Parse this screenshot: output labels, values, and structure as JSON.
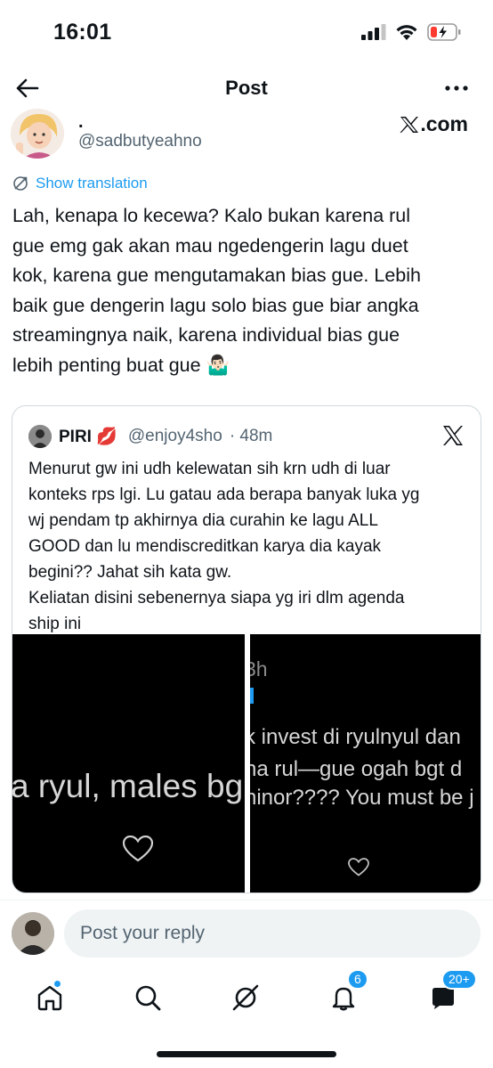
{
  "status_bar": {
    "time": "16:01"
  },
  "nav": {
    "title": "Post"
  },
  "author": {
    "name": ".",
    "handle": "@sadbutyeahno"
  },
  "watermark": {
    "text": ".com"
  },
  "translate": {
    "label": "Show translation"
  },
  "post": {
    "lines": [
      "Lah, kenapa lo kecewa? Kalo bukan karena rul",
      "gue emg gak akan mau ngedengerin lagu duet",
      "kok, karena gue mengutamakan bias gue. Lebih",
      "baik gue dengerin lagu solo bias gue biar angka",
      "streamingnya naik, karena individual bias gue",
      "lebih penting buat gue 🤷🏻‍♂️"
    ]
  },
  "quote": {
    "name": "PIRI 💋",
    "handle": "@enjoy4sho",
    "time": "· 48m",
    "lines": [
      "Menurut gw ini udh kelewatan sih krn udh di luar",
      "konteks rps lgi. Lu gatau ada berapa banyak luka yg",
      "wj pendam tp akhirnya dia curahin ke lagu ALL",
      "GOOD dan lu mendiscreditkan karya dia kayak",
      "begini?? Jahat sih kata gw.",
      "Keliatan disini sebenernya siapa yg iri dlm agenda",
      "ship ini"
    ],
    "media_left_text": "a ryul, males bg",
    "media_right": {
      "top": "3h",
      "line1": "k invest di ryulnyul dan",
      "line2": "na rul—gue ogah bgt d",
      "line3": "ninor???? You must be j"
    }
  },
  "reply": {
    "placeholder": "Post your reply"
  },
  "tabs": {
    "notifications_badge": "6",
    "messages_badge": "20+"
  },
  "colors": {
    "accent": "#1d9bf0",
    "text": "#0f1419",
    "secondary": "#536471"
  }
}
